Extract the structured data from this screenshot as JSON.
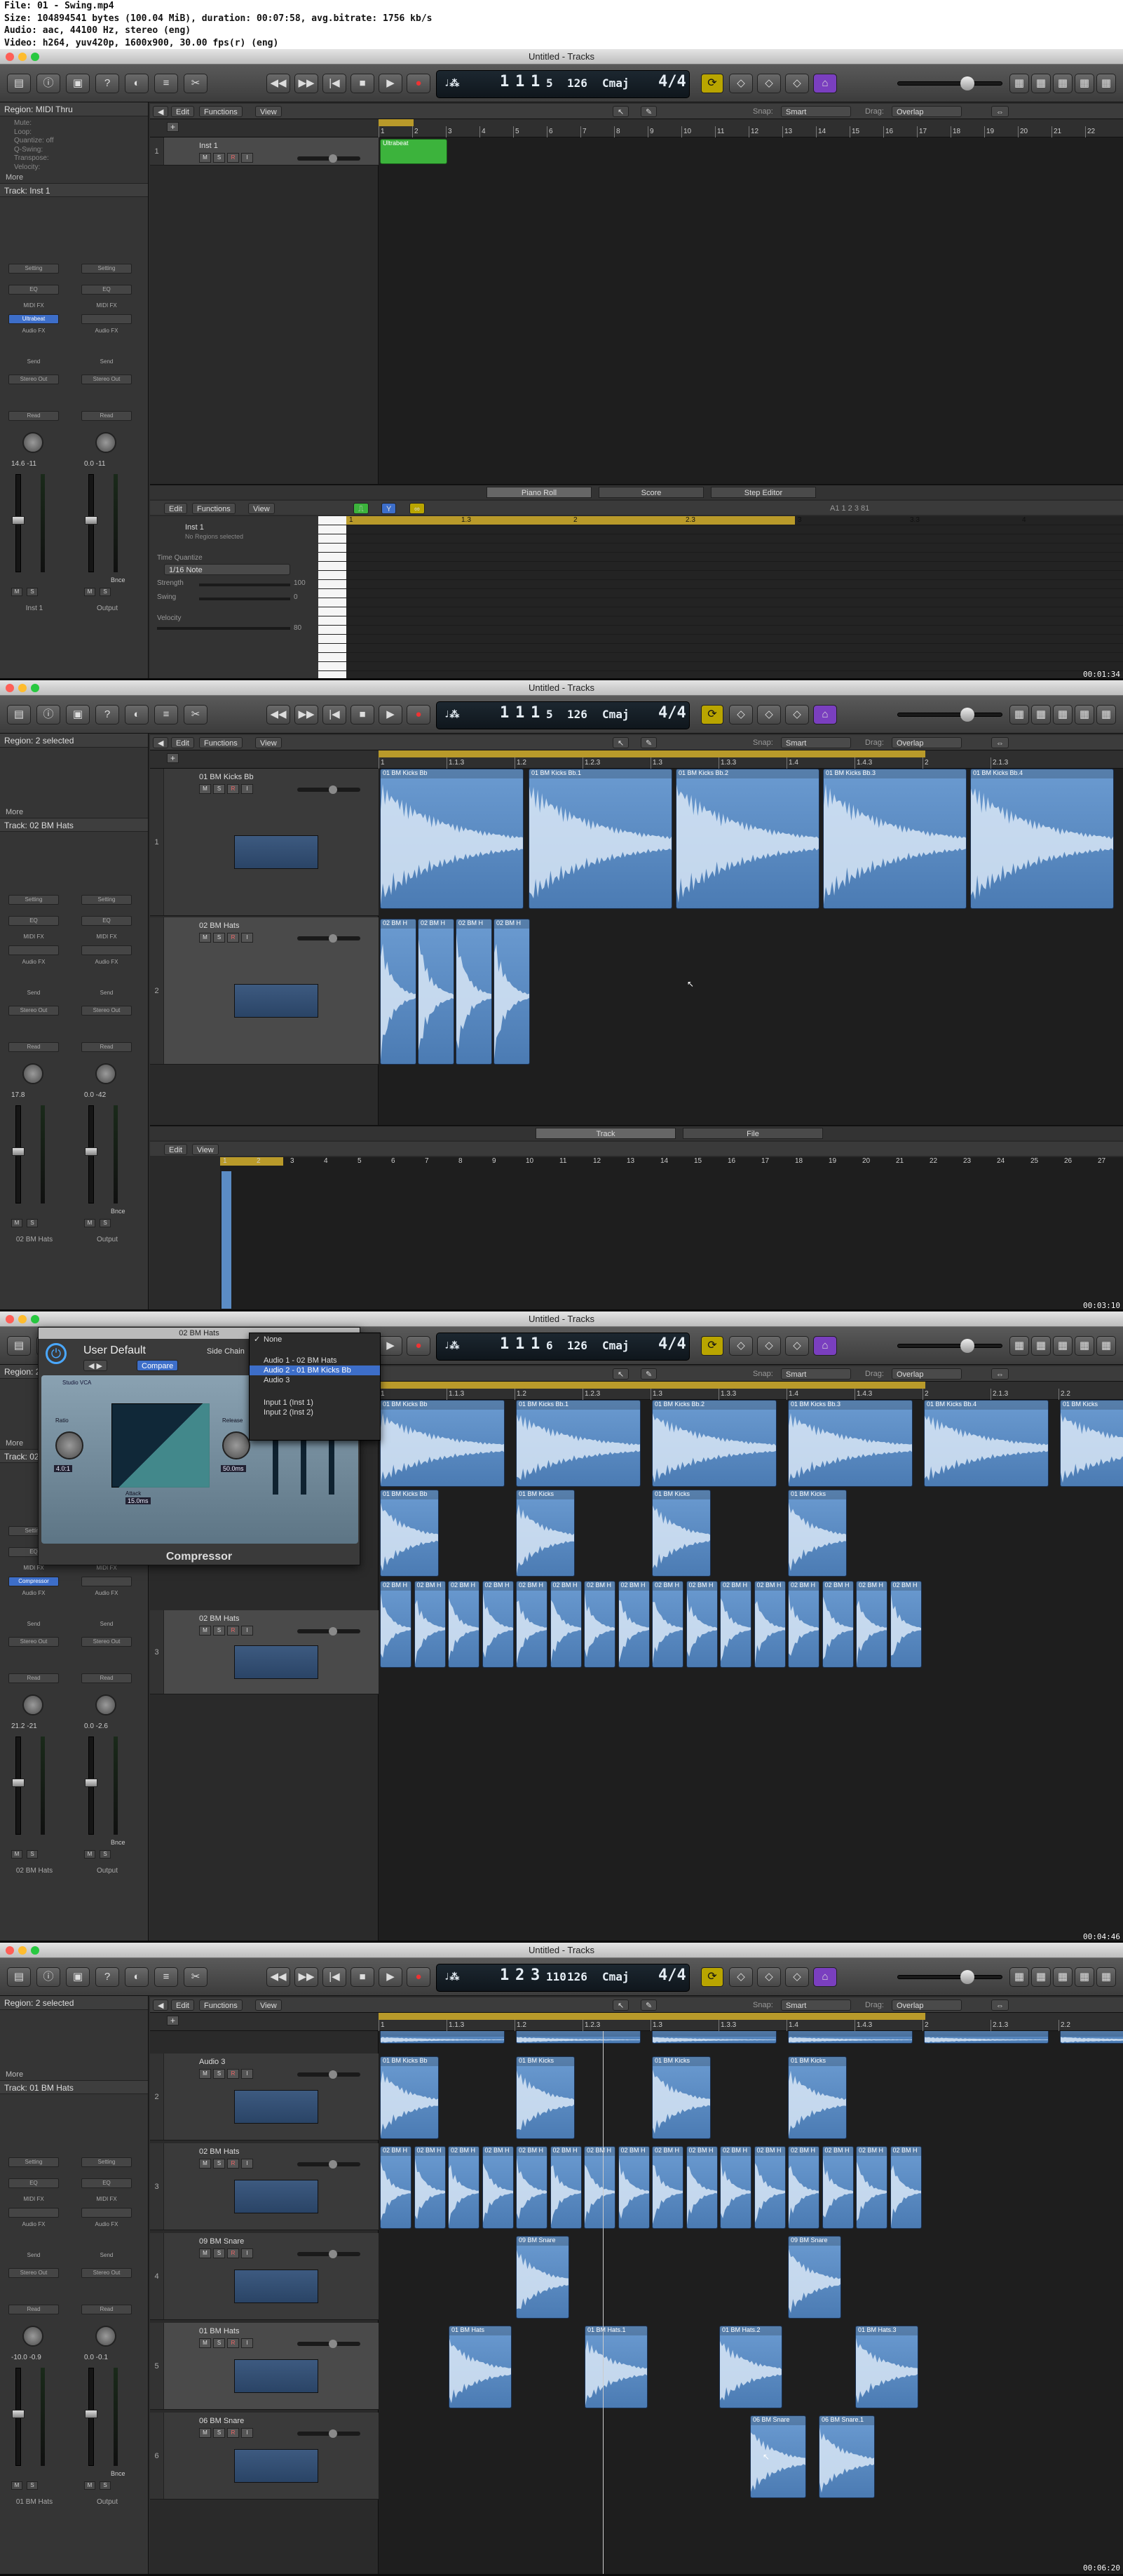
{
  "video_info": {
    "line1": "File: 01 - Swing.mp4",
    "line2": "Size: 104894541 bytes (100.04 MiB), duration: 00:07:58, avg.bitrate: 1756 kb/s",
    "line3": "Audio: aac, 44100 Hz, stereo (eng)",
    "line4": "Video: h264, yuv420p, 1600x900, 30.00 fps(r) (eng)"
  },
  "window_title": "Untitled - Tracks",
  "frames": [
    {
      "timestamp": "00:01:34",
      "lcd": {
        "bar": "1",
        "beat": "1",
        "div": "1",
        "tick": "5",
        "tempo": "126",
        "key": "Cmaj",
        "sig": "4/4"
      },
      "region_label": "Region: MIDI Thru",
      "region_props": [
        "Mute:",
        "Loop:",
        "Quantize: off",
        "Q-Swing:",
        "Transpose:",
        "Velocity:"
      ],
      "track_label": "Track: Inst 1",
      "strip_left": {
        "name": "Inst 1",
        "vals": "14.6  -11",
        "insert": "Ultrabeat",
        "send": "Stereo Out",
        "mode": "Read"
      },
      "strip_right": {
        "name": "Output",
        "vals": "0.0  -11",
        "mode": "Read"
      },
      "tracks": [
        {
          "num": "1",
          "name": "Inst 1"
        }
      ],
      "midi_region": "Ultrabeat",
      "piano_roll": {
        "tabs": [
          "Piano Roll",
          "Score",
          "Step Editor"
        ],
        "track": "Inst 1",
        "sub": "No Regions selected",
        "quantize_label": "Time Quantize",
        "quantize_value": "1/16 Note",
        "strength_label": "Strength",
        "strength_value": "100",
        "swing_label": "Swing",
        "swing_value": "0",
        "velocity_label": "Velocity",
        "velocity_value": "80",
        "pos": "A1  1 2 3 81",
        "ruler": [
          "1",
          "1.3",
          "2",
          "2.3",
          "3",
          "3.3",
          "4"
        ]
      },
      "ruler": [
        "1",
        "2",
        "3",
        "4",
        "5",
        "6",
        "7",
        "8",
        "9",
        "10",
        "11",
        "12",
        "13",
        "14",
        "15",
        "16",
        "17",
        "18",
        "19",
        "20",
        "21",
        "22"
      ]
    },
    {
      "timestamp": "00:03:10",
      "lcd": {
        "bar": "1",
        "beat": "1",
        "div": "1",
        "tick": "5",
        "tempo": "126",
        "key": "Cmaj",
        "sig": "4/4"
      },
      "region_label": "Region: 2 selected",
      "track_label": "Track: 02 BM Hats",
      "strip_left": {
        "name": "02 BM Hats",
        "vals": "17.8  ",
        "mode": "Read"
      },
      "strip_right": {
        "name": "Output",
        "vals": "0.0  -42",
        "mode": "Read"
      },
      "tracks": [
        {
          "num": "1",
          "name": "01 BM Kicks Bb"
        },
        {
          "num": "2",
          "name": "02 BM Hats"
        }
      ],
      "kick_regions": [
        "01 BM Kicks Bb",
        "01 BM Kicks Bb.1",
        "01 BM Kicks Bb.2",
        "01 BM Kicks Bb.3",
        "01 BM Kicks Bb.4"
      ],
      "hat_regions": [
        "02 BM H",
        "02 BM H",
        "02 BM H",
        "02 BM H"
      ],
      "lower_tabs": [
        "Track",
        "File"
      ],
      "ruler": [
        "1",
        "1.1.3",
        "1.2",
        "1.2.3",
        "1.3",
        "1.3.3",
        "1.4",
        "1.4.3",
        "2",
        "2.1.3"
      ],
      "lower_ruler": [
        "1",
        "2",
        "3",
        "4",
        "5",
        "6",
        "7",
        "8",
        "9",
        "10",
        "11",
        "12",
        "13",
        "14",
        "15",
        "16",
        "17",
        "18",
        "19",
        "20",
        "21",
        "22",
        "23",
        "24",
        "25",
        "26",
        "27"
      ]
    },
    {
      "timestamp": "00:04:46",
      "lcd": {
        "bar": "1",
        "beat": "1",
        "div": "1",
        "tick": "6",
        "tempo": "126",
        "key": "Cmaj",
        "sig": "4/4"
      },
      "region_label": "Region: 2 selected",
      "track_label": "Track: 02 BM Hats",
      "strip_left": {
        "name": "02 BM Hats",
        "vals": "21.2  -21",
        "insert": "Compressor",
        "send": "Stereo Out",
        "mode": "Read"
      },
      "strip_right": {
        "name": "Output",
        "vals": "0.0  -2.6",
        "mode": "Read"
      },
      "plugin": {
        "title": "02 BM Hats",
        "preset": "User Default",
        "compare": "Compare",
        "side_chain": "Side Chain",
        "name": "Compressor",
        "ratio_label": "Ratio",
        "ratio": "4.0:1",
        "attack_label": "Attack",
        "attack": "15.0ms",
        "release_label": "Release",
        "release": "50.0ms",
        "model": "Studio VCA"
      },
      "dropdown": [
        "None",
        "Audio 1 - 02 BM Hats",
        "Audio 2 - 01 BM Kicks Bb",
        "Audio 3",
        "Input 1 (Inst 1)",
        "Input 2 (Inst 2)"
      ],
      "tracks": [
        {
          "num": "3",
          "name": "02 BM Hats"
        }
      ],
      "kick_regions": [
        "01 BM Kicks Bb",
        "01 BM Kicks Bb.1",
        "01 BM Kicks Bb.2",
        "01 BM Kicks Bb.3",
        "01 BM Kicks Bb.4",
        "01 BM Kicks"
      ],
      "kick_short": [
        "01 BM Kicks Bb",
        "01 BM Kicks",
        "01 BM Kicks",
        "01 BM Kicks"
      ],
      "hat_regions": [
        "02 BM H",
        "02 BM H",
        "02 BM H",
        "02 BM H",
        "02 BM H",
        "02 BM H",
        "02 BM H",
        "02 BM H",
        "02 BM H",
        "02 BM H",
        "02 BM H",
        "02 BM H",
        "02 BM H",
        "02 BM H",
        "02 BM H",
        "02 BM H"
      ],
      "ruler": [
        "1",
        "1.1.3",
        "1.2",
        "1.2.3",
        "1.3",
        "1.3.3",
        "1.4",
        "1.4.3",
        "2",
        "2.1.3",
        "2.2"
      ]
    },
    {
      "timestamp": "00:06:20",
      "lcd": {
        "bar": "1",
        "beat": "2",
        "div": "3",
        "tick": "110",
        "tempo": "126",
        "key": "Cmaj",
        "sig": "4/4"
      },
      "region_label": "Region: 2 selected",
      "track_label": "Track: 01 BM Hats",
      "strip_left": {
        "name": "01 BM Hats",
        "vals": "-10.0  -0.9",
        "mode": "Read"
      },
      "strip_right": {
        "name": "Output",
        "vals": "0.0  -0.1",
        "mode": "Read"
      },
      "tracks": [
        {
          "num": "2",
          "name": "Audio 3"
        },
        {
          "num": "3",
          "name": "02 BM Hats"
        },
        {
          "num": "4",
          "name": "09 BM Snare"
        },
        {
          "num": "5",
          "name": "01 BM Hats"
        },
        {
          "num": "6",
          "name": "06 BM Snare"
        }
      ],
      "audio3_regions": [
        "01 BM Kicks Bb",
        "01 BM Kicks",
        "01 BM Kicks",
        "01 BM Kicks"
      ],
      "hat_regions": [
        "02 BM H",
        "02 BM H",
        "02 BM H",
        "02 BM H",
        "02 BM H",
        "02 BM H",
        "02 BM H",
        "02 BM H",
        "02 BM H",
        "02 BM H",
        "02 BM H",
        "02 BM H",
        "02 BM H",
        "02 BM H",
        "02 BM H",
        "02 BM H"
      ],
      "snare9_regions": [
        "09 BM Snare",
        "09 BM Snare"
      ],
      "hats1_regions": [
        "01 BM Hats",
        "01 BM Hats.1",
        "01 BM Hats.2",
        "01 BM Hats.3"
      ],
      "snare6_regions": [
        "06 BM Snare",
        "06 BM Snare.1"
      ],
      "ruler": [
        "1",
        "1.1.3",
        "1.2",
        "1.2.3",
        "1.3",
        "1.3.3",
        "1.4",
        "1.4.3",
        "2",
        "2.1.3",
        "2.2"
      ]
    }
  ],
  "ui": {
    "edit": "Edit",
    "functions": "Functions",
    "view": "View",
    "snap": "Snap:",
    "snap_val": "Smart",
    "drag": "Drag:",
    "drag_val": "Overlap",
    "more": "More",
    "setting": "Setting",
    "eq": "EQ",
    "midi_fx": "MIDI FX",
    "audio_fx": "Audio FX",
    "send": "Send",
    "stereo_out": "Stereo Out",
    "bnce": "Bnce",
    "m": "M",
    "s": "S",
    "r": "R",
    "i": "I"
  },
  "colors": {
    "region_blue": "#5b8cc4",
    "midi_green": "#3cb33c",
    "ruler_gold": "#b99a2a",
    "accent": "#3d6ec9"
  }
}
